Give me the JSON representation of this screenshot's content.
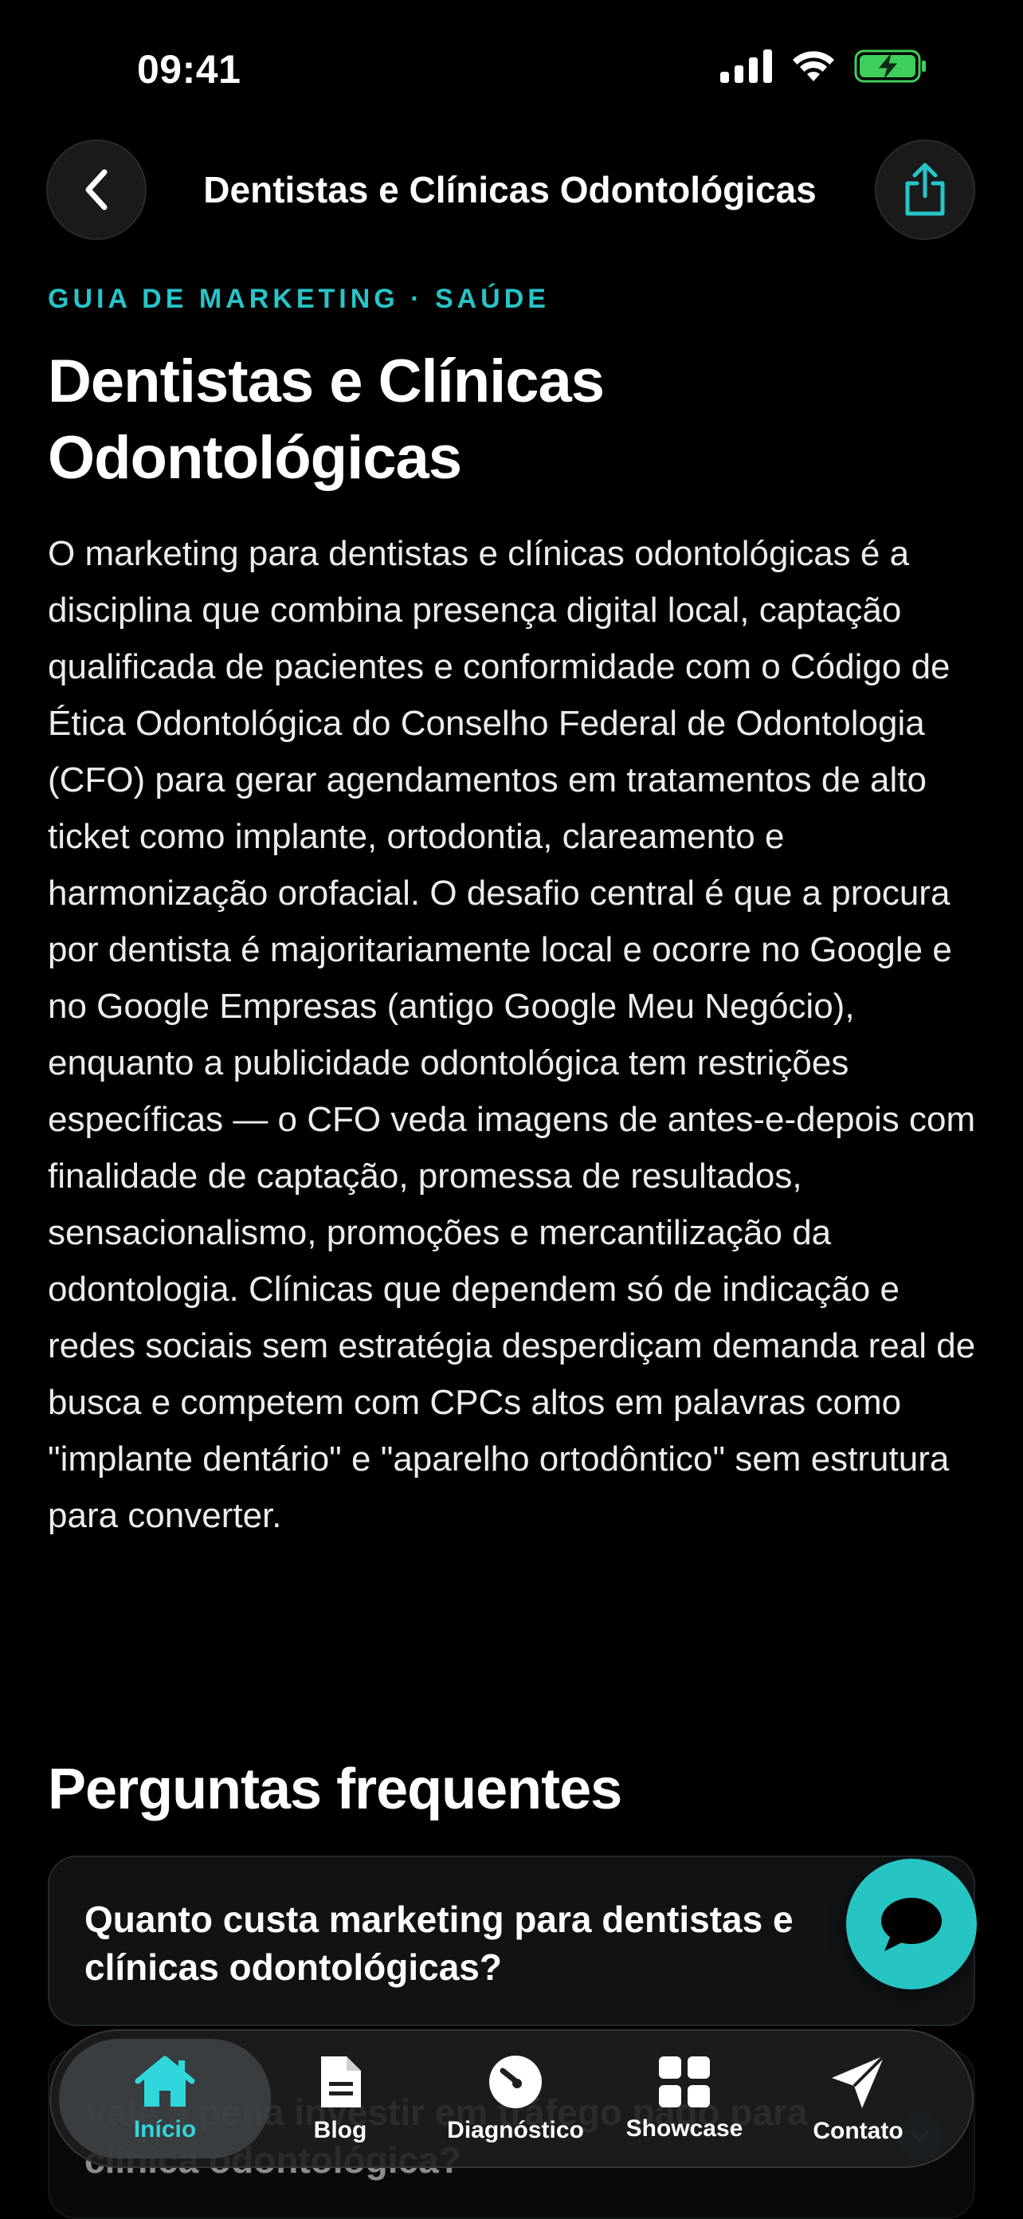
{
  "status": {
    "time": "09:41"
  },
  "header": {
    "title": "Dentistas e Clínicas Odontológicas"
  },
  "article": {
    "eyebrow": "GUIA DE MARKETING · SAÚDE",
    "title": "Dentistas e Clínicas Odontológicas",
    "intro": "O marketing para dentistas e clínicas odontológicas é a disciplina que combina presença digital local, captação qualificada de pacientes e conformidade com o Código de Ética Odontológica do Conselho Federal de Odontologia (CFO) para gerar agendamentos em tratamentos de alto ticket como implante, ortodontia, clareamento e harmonização orofacial. O desafio central é que a procura por dentista é majoritariamente local e ocorre no Google e no Google Empresas (antigo Google Meu Negócio), enquanto a publicidade odontológica tem restrições específicas — o CFO veda imagens de antes-e-depois com finalidade de captação, promessa de resultados, sensacionalismo, promoções e mercantilização da odontologia. Clínicas que dependem só de indicação e redes sociais sem estratégia desperdiçam demanda real de busca e competem com CPCs altos em palavras como \"implante dentário\" e \"aparelho ortodôntico\" sem estrutura para converter."
  },
  "faq": {
    "heading": "Perguntas frequentes",
    "items": [
      {
        "question": "Quanto custa marketing para dentistas e clínicas odontológicas?"
      },
      {
        "question": "Vale a pena investir em tráfego pago para clínica odontológica?"
      }
    ]
  },
  "tabs": [
    {
      "label": "Início",
      "icon": "home-icon"
    },
    {
      "label": "Blog",
      "icon": "document-icon"
    },
    {
      "label": "Diagnóstico",
      "icon": "gauge-icon"
    },
    {
      "label": "Showcase",
      "icon": "grid-icon"
    },
    {
      "label": "Contato",
      "icon": "send-icon"
    }
  ],
  "colors": {
    "accent": "#27C4C8",
    "background": "#000000",
    "battery": "#3ECF5A"
  }
}
